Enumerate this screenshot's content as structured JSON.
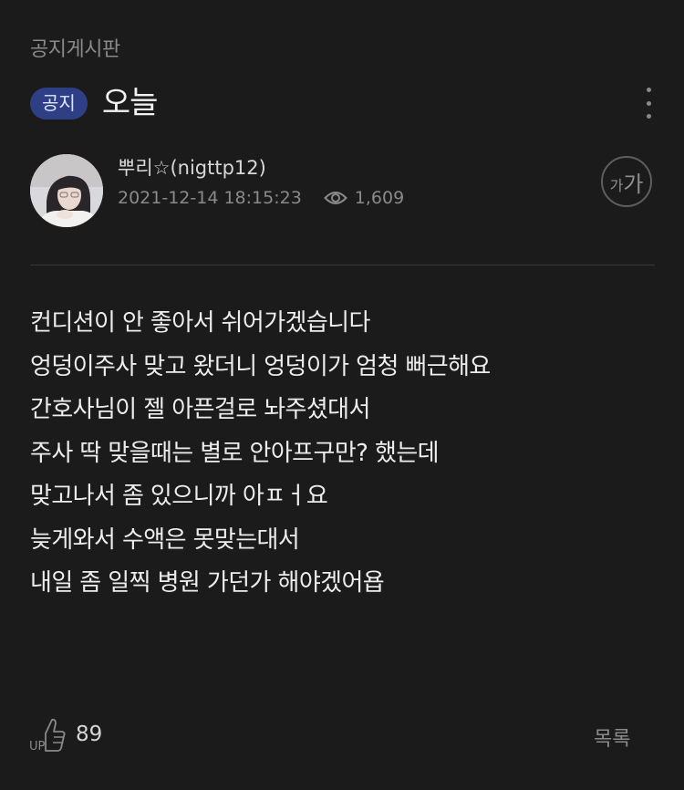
{
  "board": {
    "name": "공지게시판"
  },
  "post": {
    "badge": "공지",
    "title": "오늘",
    "author": "뿌리☆(nigttp12)",
    "datetime": "2021-12-14 18:15:23",
    "views": "1,609",
    "body_lines": [
      "컨디션이 안 좋아서 쉬어가겠습니다",
      "엉덩이주사 맞고 왔더니 엉덩이가 엄청 뻐근해요",
      "간호사님이 젤 아픈걸로 놔주셨대서",
      "주사 딱 맞을때는 별로 안아프구만? 했는데",
      "맞고나서 좀 있으니까 아ㅍㅓ요",
      "늦게와서 수액은 못맞는대서",
      "내일 좀 일찍 병원 가던가 해야겠어욥"
    ]
  },
  "font_size_button": {
    "small": "가",
    "big": "가"
  },
  "footer": {
    "like_label": "UP",
    "like_count": "89",
    "list_label": "목록"
  },
  "icons": {
    "more": "more-vertical-icon",
    "views": "eye-icon",
    "like": "thumbs-up-icon"
  },
  "colors": {
    "background": "#1b1b1b",
    "badge": "#2f3f86",
    "text": "#ededed",
    "muted": "#8a8a8a"
  }
}
